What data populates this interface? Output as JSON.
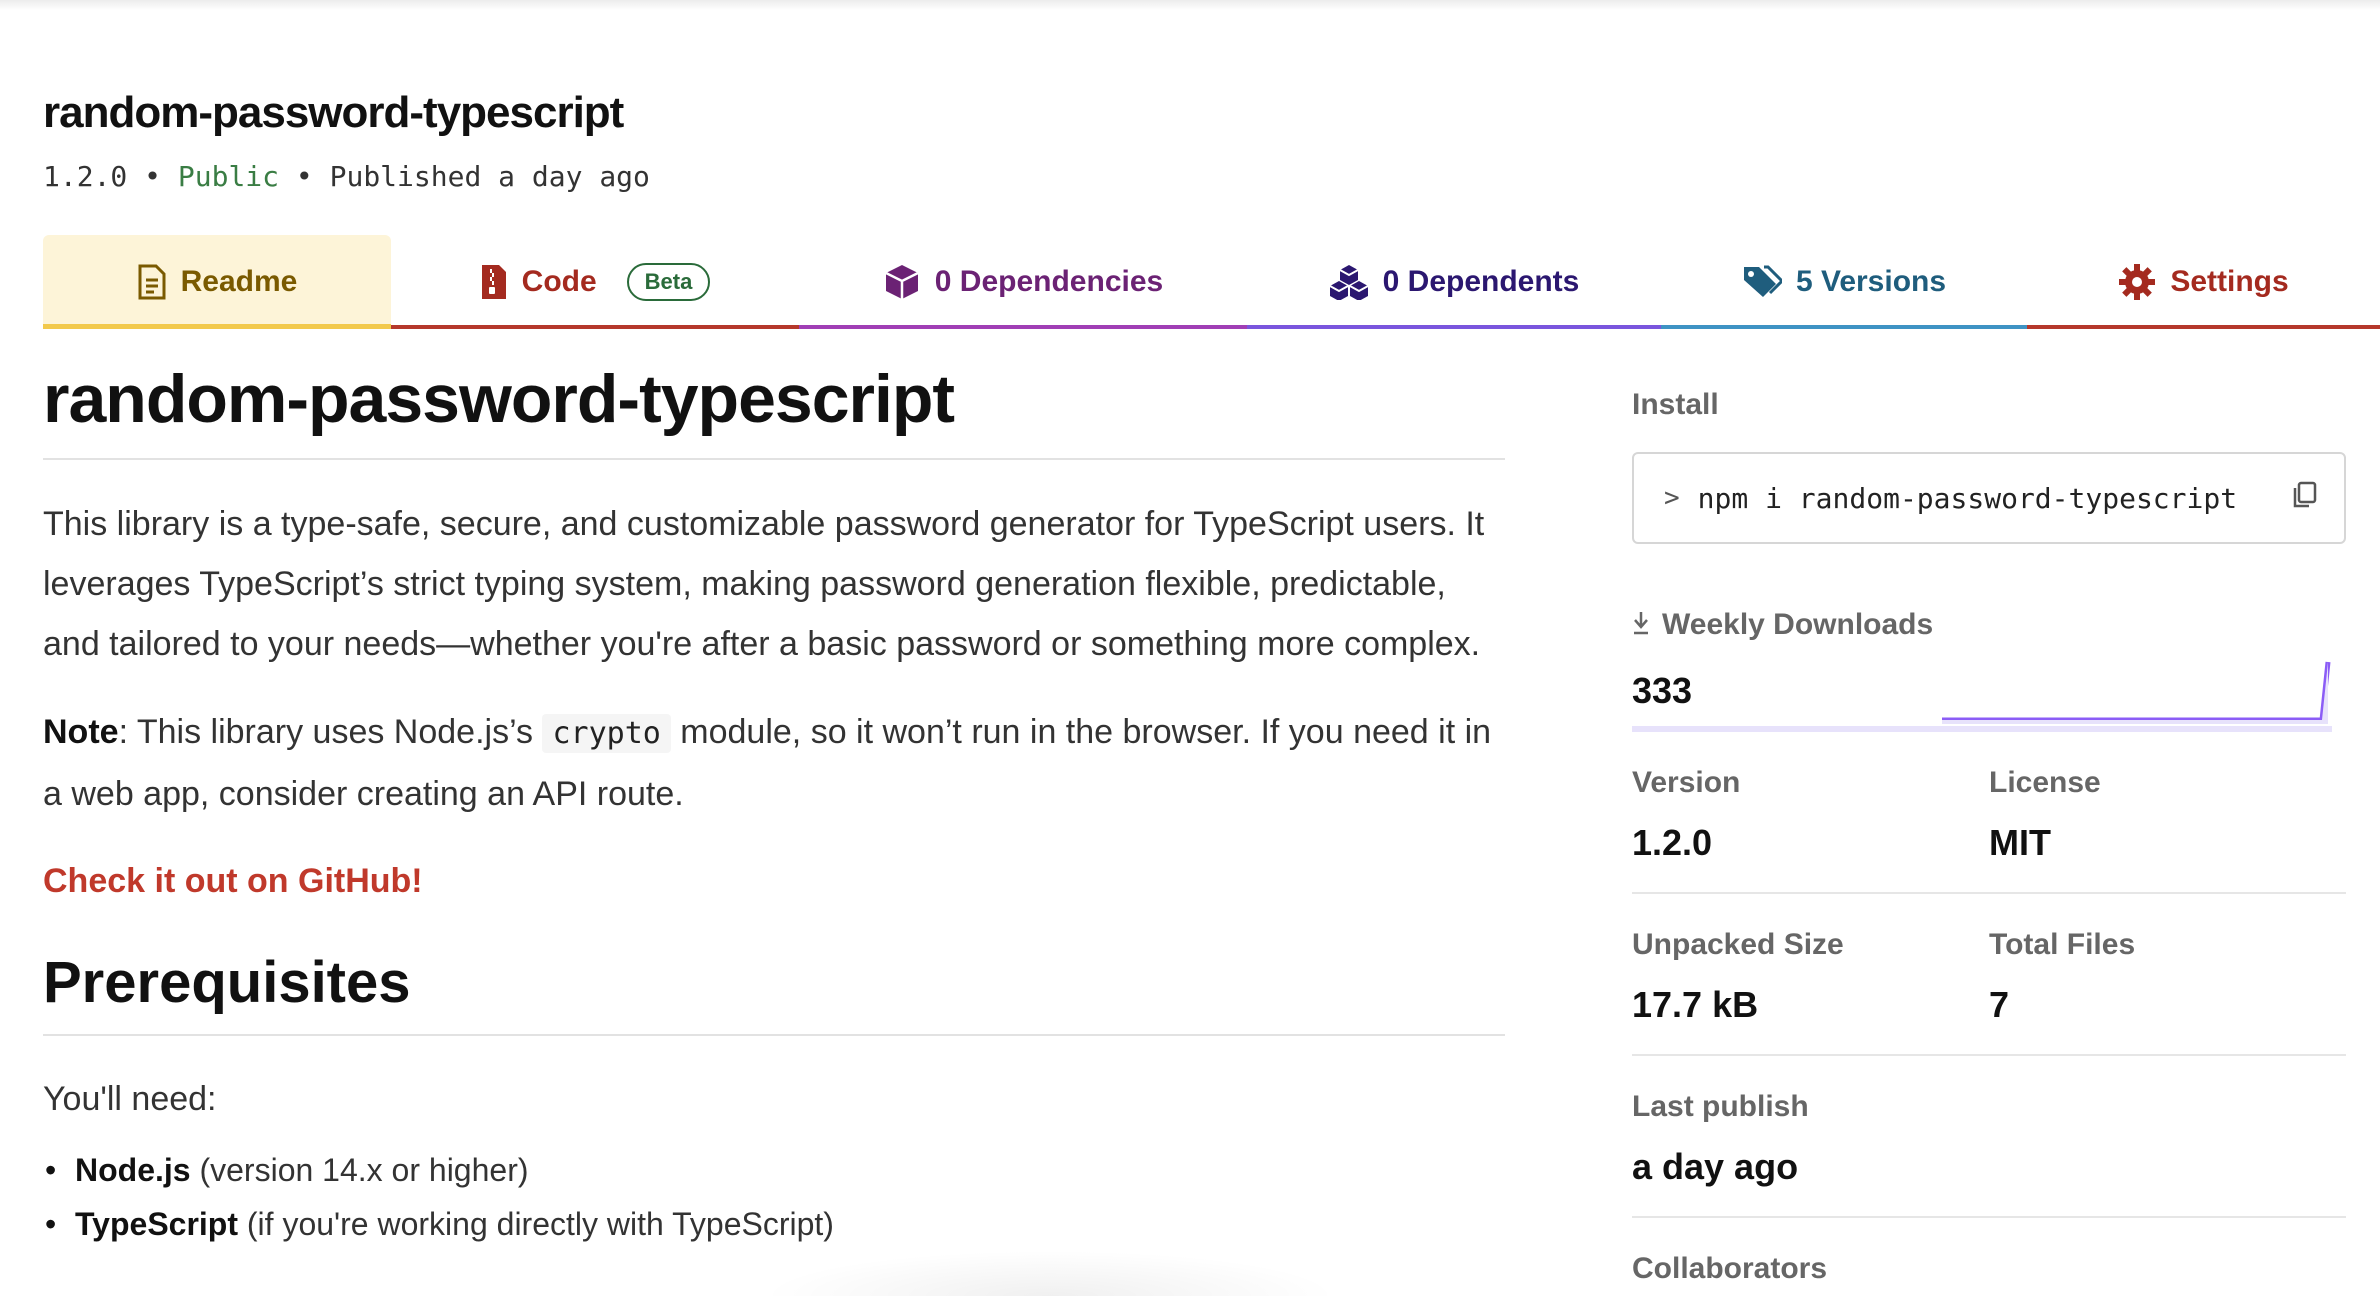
{
  "package": {
    "name": "random-password-typescript",
    "version": "1.2.0",
    "separator": "•",
    "visibility": "Public",
    "published": "Published a day ago"
  },
  "tabs": {
    "readme": {
      "label": "Readme",
      "icon": "readme-file-icon"
    },
    "code": {
      "label": "Code",
      "badge": "Beta",
      "icon": "code-zip-icon"
    },
    "dependencies": {
      "label": "0 Dependencies",
      "icon": "box-icon"
    },
    "dependents": {
      "label": "0 Dependents",
      "icon": "cubes-icon"
    },
    "versions": {
      "label": "5 Versions",
      "icon": "tags-icon"
    },
    "settings": {
      "label": "Settings",
      "icon": "gear-icon"
    },
    "active": "readme"
  },
  "readme": {
    "title": "random-password-typescript",
    "intro": "This library is a type-safe, secure, and customizable password generator for TypeScript users. It leverages TypeScript’s strict typing system, making password generation flexible, predictable, and tailored to your needs—whether you're after a basic password or something more complex.",
    "note_label": "Note",
    "note_before": ": This library uses Node.js’s ",
    "note_code": "crypto",
    "note_after": " module, so it won’t run in the browser. If you need it in a web app, consider creating an API route.",
    "github_link": "Check it out on GitHub!",
    "prereq_heading": "Prerequisites",
    "need_text": "You'll need:",
    "requirements": [
      {
        "name": "Node.js",
        "detail": " (version 14.x or higher)"
      },
      {
        "name": "TypeScript",
        "detail": " (if you're working directly with TypeScript)"
      }
    ]
  },
  "sidebar": {
    "install_label": "Install",
    "install_prompt": ">",
    "install_command": "npm i random-password-typescript",
    "weekly_downloads_label": "Weekly Downloads",
    "weekly_downloads": "333",
    "version_label": "Version",
    "version": "1.2.0",
    "license_label": "License",
    "license": "MIT",
    "unpacked_size_label": "Unpacked Size",
    "unpacked_size": "17.7 kB",
    "total_files_label": "Total Files",
    "total_files": "7",
    "last_publish_label": "Last publish",
    "last_publish": "a day ago",
    "collaborators_label": "Collaborators"
  },
  "colors": {
    "readme_tab": "#f2c94c",
    "code_tab": "#b5382b",
    "deps_tab": "#a03eb5",
    "dependents_tab": "#7a55dd",
    "versions_tab": "#3e93c4",
    "settings_tab": "#b5382b",
    "link": "#c0392b",
    "public": "#3a7d44",
    "sparkline": "#8b5cf6"
  }
}
